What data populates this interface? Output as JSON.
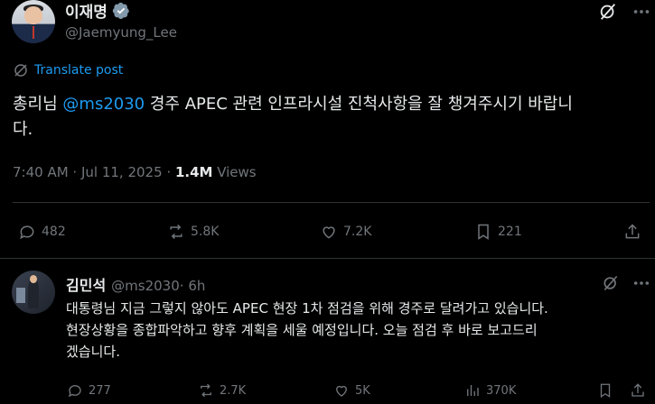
{
  "main_post": {
    "author_name": "이재명",
    "author_handle": "@Jaemyung_Lee",
    "translate_label": "Translate post",
    "text_prefix": "총리님 ",
    "mention": "@ms2030",
    "text_line1_rest": " 경주 APEC 관련 인프라시설 진척사항을 잘 챙겨주시기 바랍니",
    "text_line2": "다.",
    "meta_time": "7:40 AM · Jul 11, 2025 · ",
    "views_count": "1.4M",
    "views_label": " Views",
    "replies": "482",
    "reposts": "5.8K",
    "likes": "7.2K",
    "bookmarks": "221"
  },
  "reply_post": {
    "author_name": "김민석",
    "author_handle": "@ms2030",
    "time": " · 6h",
    "line1": "대통령님 지금 그렇지 않아도 APEC 현장 1차 점검을 위해 경주로 달려가고 있습니다.",
    "line2": "현장상황을 종합파악하고 향후 계획을 세울 예정입니다. 오늘 점검 후 바로 보고드리",
    "line3": "겠습니다.",
    "replies": "277",
    "reposts": "2.7K",
    "likes": "5K",
    "views": "370K"
  },
  "colors": {
    "background": "#000000",
    "text": "#e7e9ea",
    "muted": "#71767b",
    "accent": "#1d9bf0",
    "divider": "#2f3336"
  },
  "icons": [
    "verified-badge-icon",
    "grok-icon",
    "globe-icon",
    "reply-icon",
    "repost-icon",
    "like-icon",
    "bookmark-icon",
    "share-icon",
    "views-icon"
  ]
}
